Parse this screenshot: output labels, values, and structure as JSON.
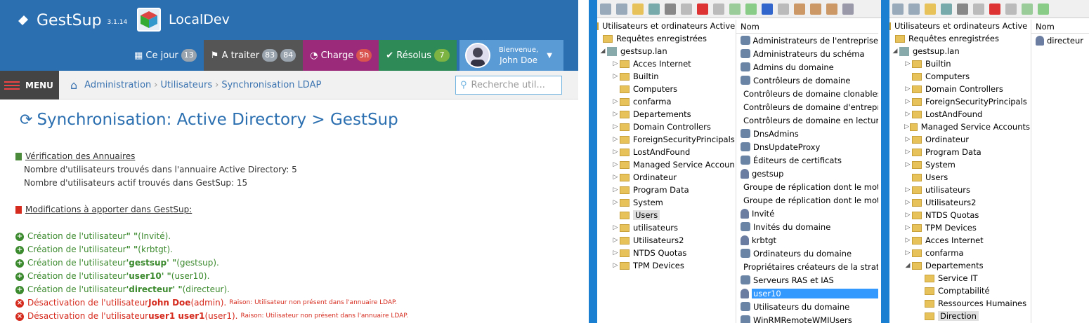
{
  "gestsup": {
    "app_name": "GestSup",
    "version": "3.1.14",
    "env_name": "LocalDev",
    "tabs": [
      {
        "label": "Ce jour",
        "count": "13",
        "bg": "#2b6fb0",
        "icon": "calendar-icon"
      },
      {
        "label": "A traiter",
        "count": "83",
        "count2": "84",
        "bg": "#555555",
        "icon": "flag-icon"
      },
      {
        "label": "Charge",
        "count": "5h",
        "bg": "#9b2a7a",
        "icon": "gauge-icon",
        "badge": "#d9534f"
      },
      {
        "label": "Résolus",
        "count": "7",
        "bg": "#2e8b57",
        "icon": "check-icon",
        "badge": "#7cb342"
      }
    ],
    "user": {
      "welcome": "Bienvenue,",
      "name": "John Doe"
    },
    "menu_label": "MENU",
    "breadcrumb": [
      "Administration",
      "Utilisateurs",
      "Synchronisation LDAP"
    ],
    "search_placeholder": "Recherche util...",
    "page_title": "Synchronisation: Active Directory > GestSup",
    "verif": {
      "title": "Vérification des Annuaires",
      "lines": [
        "Nombre d'utilisateurs trouvés dans l'annuaire Active Directory: 5",
        "Nombre d'utilisateurs actif trouvés dans GestSup: 15"
      ]
    },
    "mods_title": "Modifications à apporter dans GestSup:",
    "creations": [
      {
        "pre": "Création de l'utilisateur ",
        "bold": "\" \"",
        "post": " (Invité)."
      },
      {
        "pre": "Création de l'utilisateur ",
        "bold": "\" \"",
        "post": " (krbtgt)."
      },
      {
        "pre": "Création de l'utilisateur ",
        "bold": "'gestsup' \"",
        "post": " (gestsup)."
      },
      {
        "pre": "Création de l'utilisateur ",
        "bold": "'user10' \"",
        "post": " (user10)."
      },
      {
        "pre": "Création de l'utilisateur ",
        "bold": "'directeur' \"",
        "post": " (directeur)."
      }
    ],
    "deactivations": [
      {
        "pre": "Désactivation de l'utilisateur ",
        "bold": "John Doe",
        "post": " (admin).",
        "reason": "Raison: Utilisateur non présent dans l'annuaire LDAP."
      },
      {
        "pre": "Désactivation de l'utilisateur ",
        "bold": "user1 user1",
        "post": " (user1).",
        "reason": "Raison: Utilisateur non présent dans l'annuaire LDAP."
      }
    ]
  },
  "ad1": {
    "root": "Utilisateurs et ordinateurs Active",
    "saved": "Requêtes enregistrées",
    "domain": "gestsup.lan",
    "folders": [
      {
        "name": "Acces Internet",
        "arrow": true
      },
      {
        "name": "Builtin",
        "arrow": true
      },
      {
        "name": "Computers",
        "arrow": false
      },
      {
        "name": "confarma",
        "arrow": true
      },
      {
        "name": "Departements",
        "arrow": true
      },
      {
        "name": "Domain Controllers",
        "arrow": true
      },
      {
        "name": "ForeignSecurityPrincipals",
        "arrow": true
      },
      {
        "name": "LostAndFound",
        "arrow": true
      },
      {
        "name": "Managed Service Accoun",
        "arrow": true
      },
      {
        "name": "Ordinateur",
        "arrow": true
      },
      {
        "name": "Program Data",
        "arrow": true
      },
      {
        "name": "System",
        "arrow": true
      },
      {
        "name": "Users",
        "arrow": false,
        "selected": true
      },
      {
        "name": "utilisateurs",
        "arrow": true
      },
      {
        "name": "Utilisateurs2",
        "arrow": true
      },
      {
        "name": "NTDS Quotas",
        "arrow": true
      },
      {
        "name": "TPM Devices",
        "arrow": true
      }
    ],
    "col": "Nom",
    "items": [
      {
        "name": "Administrateurs de l'entreprise",
        "t": "g"
      },
      {
        "name": "Administrateurs du schéma",
        "t": "g"
      },
      {
        "name": "Admins du domaine",
        "t": "g"
      },
      {
        "name": "Contrôleurs de domaine",
        "t": "g"
      },
      {
        "name": "Contrôleurs de domaine clonables",
        "t": "g"
      },
      {
        "name": "Contrôleurs de domaine d'entrepr",
        "t": "g"
      },
      {
        "name": "Contrôleurs de domaine en lectur",
        "t": "g"
      },
      {
        "name": "DnsAdmins",
        "t": "g"
      },
      {
        "name": "DnsUpdateProxy",
        "t": "g"
      },
      {
        "name": "Éditeurs de certificats",
        "t": "g"
      },
      {
        "name": "gestsup",
        "t": "u"
      },
      {
        "name": "Groupe de réplication dont le mot",
        "t": "g"
      },
      {
        "name": "Groupe de réplication dont le mot",
        "t": "g"
      },
      {
        "name": "Invité",
        "t": "u"
      },
      {
        "name": "Invités du domaine",
        "t": "g"
      },
      {
        "name": "krbtgt",
        "t": "u"
      },
      {
        "name": "Ordinateurs du domaine",
        "t": "g"
      },
      {
        "name": "Propriétaires créateurs de la straté",
        "t": "g"
      },
      {
        "name": "Serveurs RAS et IAS",
        "t": "g"
      },
      {
        "name": "user10",
        "t": "u",
        "selected": true
      },
      {
        "name": "Utilisateurs du domaine",
        "t": "g"
      },
      {
        "name": "WinRMRemoteWMIUsers_",
        "t": "g"
      }
    ]
  },
  "ad2": {
    "root": "Utilisateurs et ordinateurs Active Dir",
    "saved": "Requêtes enregistrées",
    "domain": "gestsup.lan",
    "folders": [
      {
        "name": "Builtin",
        "arrow": true,
        "lvl": 1
      },
      {
        "name": "Computers",
        "arrow": false,
        "lvl": 1
      },
      {
        "name": "Domain Controllers",
        "arrow": true,
        "lvl": 1
      },
      {
        "name": "ForeignSecurityPrincipals",
        "arrow": true,
        "lvl": 1
      },
      {
        "name": "LostAndFound",
        "arrow": true,
        "lvl": 1
      },
      {
        "name": "Managed Service Accounts",
        "arrow": true,
        "lvl": 1
      },
      {
        "name": "Ordinateur",
        "arrow": true,
        "lvl": 1
      },
      {
        "name": "Program Data",
        "arrow": true,
        "lvl": 1
      },
      {
        "name": "System",
        "arrow": true,
        "lvl": 1
      },
      {
        "name": "Users",
        "arrow": false,
        "lvl": 1
      },
      {
        "name": "utilisateurs",
        "arrow": true,
        "lvl": 1
      },
      {
        "name": "Utilisateurs2",
        "arrow": true,
        "lvl": 1
      },
      {
        "name": "NTDS Quotas",
        "arrow": true,
        "lvl": 1
      },
      {
        "name": "TPM Devices",
        "arrow": true,
        "lvl": 1
      },
      {
        "name": "Acces Internet",
        "arrow": true,
        "lvl": 1
      },
      {
        "name": "confarma",
        "arrow": true,
        "lvl": 1
      },
      {
        "name": "Departements",
        "arrow": "open",
        "lvl": 1
      },
      {
        "name": "Service IT",
        "arrow": false,
        "lvl": 2
      },
      {
        "name": "Comptabilité",
        "arrow": false,
        "lvl": 2
      },
      {
        "name": "Ressources Humaines",
        "arrow": false,
        "lvl": 2
      },
      {
        "name": "Direction",
        "arrow": false,
        "lvl": 2,
        "selected": true
      }
    ],
    "col": "Nom",
    "items": [
      {
        "name": "directeur",
        "t": "u"
      }
    ]
  }
}
